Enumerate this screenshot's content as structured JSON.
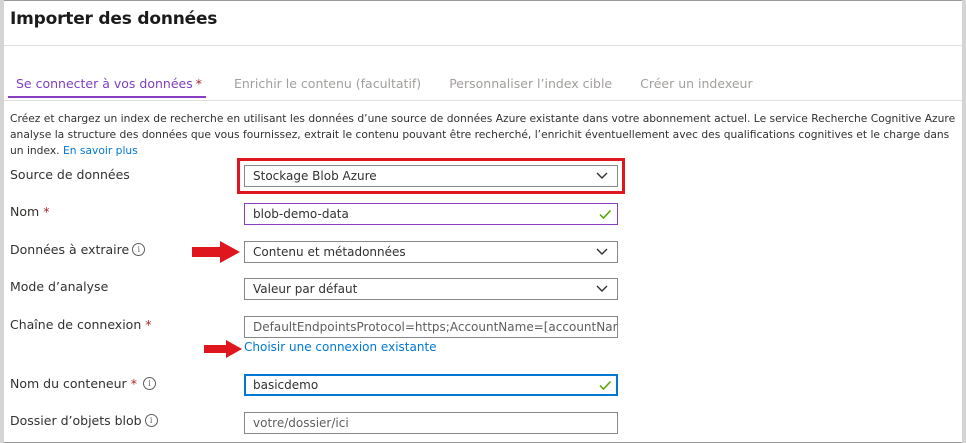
{
  "page_title": "Importer des données",
  "tabs": [
    {
      "label": "Se connecter à vos données",
      "required": "*"
    },
    {
      "label": "Enrichir le contenu (facultatif)"
    },
    {
      "label": "Personnaliser l’index cible"
    },
    {
      "label": "Créer un indexeur"
    }
  ],
  "description": {
    "text": "Créez et chargez un index de recherche en utilisant les données d’une source de données Azure existante dans votre abonnement actuel. Le service Recherche Cognitive Azure analyse la structure des données que vous fournissez, extrait le contenu pouvant être recherché, l’enrichit éventuellement avec des qualifications cognitives et le charge dans un index.",
    "link": "En savoir plus"
  },
  "form": {
    "source": {
      "label": "Source de données",
      "value": "Stockage Blob Azure"
    },
    "nom": {
      "label": "Nom",
      "required": "*",
      "value": "blob-demo-data"
    },
    "donnees": {
      "label": "Données à extraire",
      "value": "Contenu et métadonnées"
    },
    "mode": {
      "label": "Mode d’analyse",
      "value": "Valeur par défaut"
    },
    "chaine": {
      "label": "Chaîne de connexion",
      "required": "*",
      "placeholder": "DefaultEndpointsProtocol=https;AccountName=[accountName];AccountKey=",
      "link": "Choisir une connexion existante"
    },
    "conteneur": {
      "label": "Nom du conteneur",
      "required": "*",
      "value": "basicdemo"
    },
    "dossier": {
      "label": "Dossier d’objets blob",
      "placeholder": "votre/dossier/ici"
    }
  },
  "icons": {
    "info": "info-icon",
    "chevron": "chevron-down-icon",
    "check": "checkmark-icon",
    "arrow": "red-arrow-icon"
  },
  "colors": {
    "accent_purple": "#8a3ec0",
    "link_blue": "#0078d4",
    "valid_green": "#57a300",
    "highlight_red": "#e0161f",
    "required_red": "#a4262c"
  }
}
